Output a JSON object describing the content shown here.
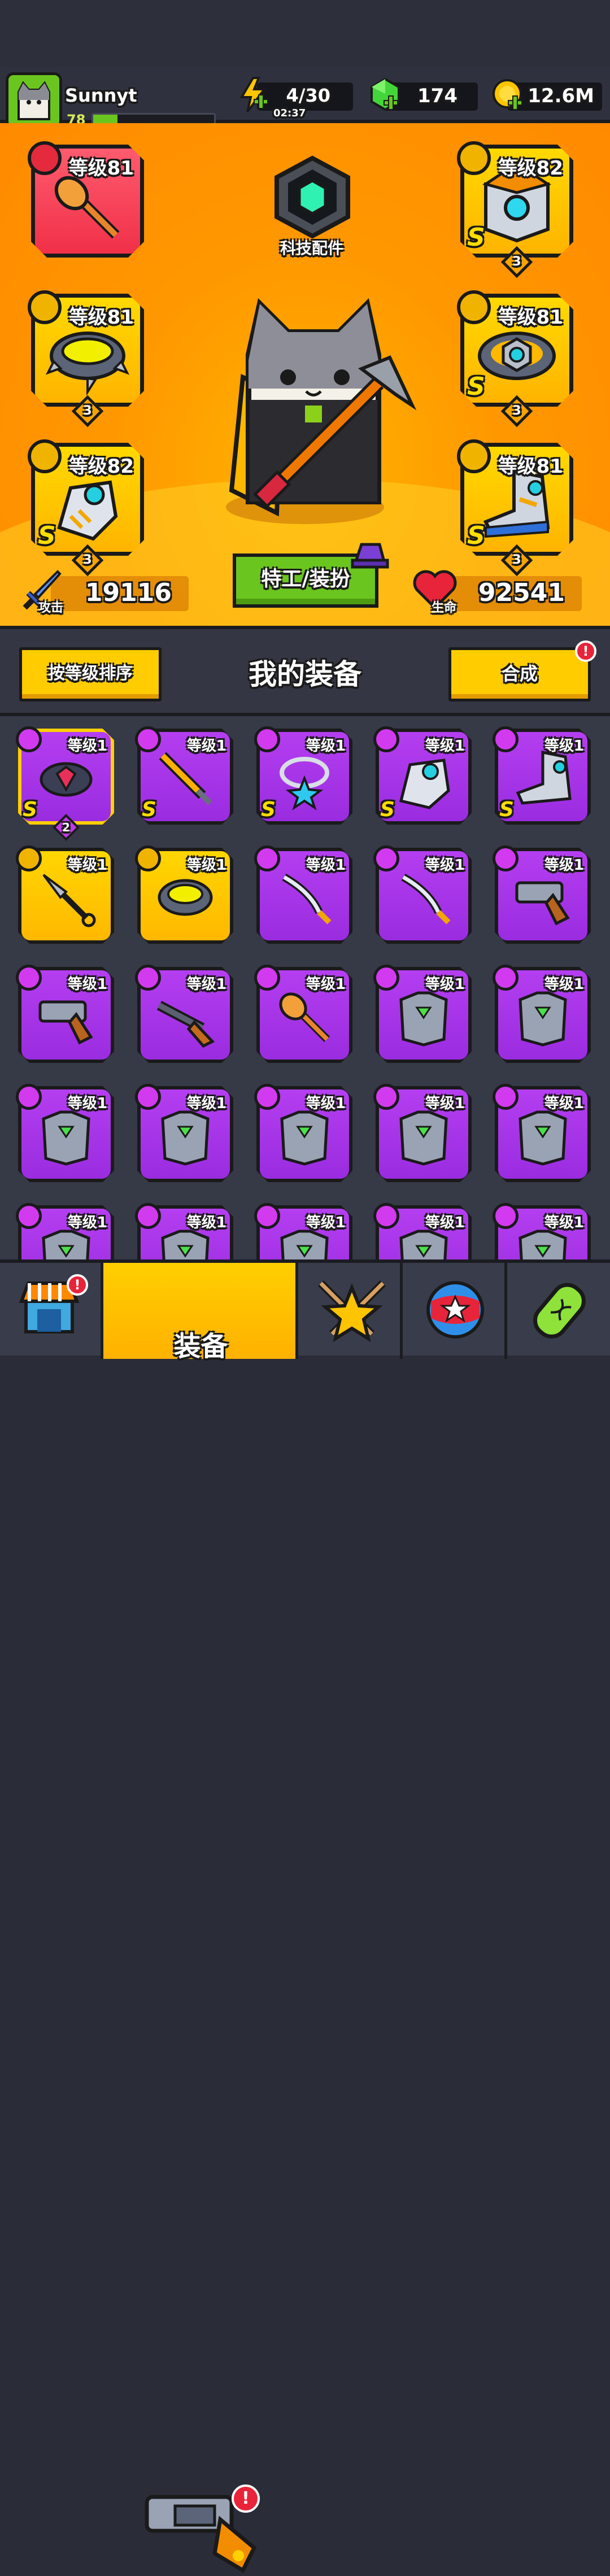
{
  "player": {
    "name": "Sunnyt",
    "level": "78",
    "xp_fraction": 0.2
  },
  "resources": {
    "energy": {
      "value": "4/30",
      "timer": "02:37",
      "icon": "lightning-plus-icon"
    },
    "gems": {
      "value": "174",
      "icon": "green-gem-plus-icon"
    },
    "gold": {
      "value": "12.6M",
      "icon": "gold-coin-plus-icon"
    }
  },
  "equipped": {
    "weapon": {
      "level": "等级81",
      "icon": "mace-weapon-icon"
    },
    "armor": {
      "level": "等级82",
      "icon": "robot-armor-icon",
      "stars": "3"
    },
    "necklace": {
      "level": "等级81",
      "icon": "spiked-necklace-icon",
      "stars": "3"
    },
    "belt": {
      "level": "等级81",
      "icon": "mech-belt-icon",
      "stars": "3"
    },
    "gloves": {
      "level": "等级82",
      "icon": "mech-glove-icon",
      "stars": "3"
    },
    "boots": {
      "level": "等级81",
      "icon": "mech-boots-icon",
      "stars": "3"
    },
    "rank_letter": "S"
  },
  "tech": {
    "label": "科技配件"
  },
  "costume_button": "特工/装扮",
  "stats": {
    "attack": {
      "label": "攻击",
      "value": "19116"
    },
    "hp": {
      "label": "生命",
      "value": "92541"
    }
  },
  "panel": {
    "sort_button": "按等级排序",
    "title": "我的装备",
    "merge_button": "合成",
    "merge_badge": "!"
  },
  "inventory_level": "等级1",
  "inventory": [
    {
      "rarity": "purple",
      "selected": true,
      "rank": "S",
      "stars": "2",
      "icon": "belt-icon"
    },
    {
      "rarity": "purple",
      "rank": "S",
      "icon": "flame-sword-icon"
    },
    {
      "rarity": "purple",
      "rank": "S",
      "icon": "star-necklace-icon"
    },
    {
      "rarity": "purple",
      "rank": "S",
      "icon": "mech-glove-icon"
    },
    {
      "rarity": "purple",
      "rank": "S",
      "icon": "mech-boots-icon"
    },
    {
      "rarity": "yellow",
      "icon": "kunai-icon"
    },
    {
      "rarity": "yellow",
      "icon": "spiked-necklace-icon"
    },
    {
      "rarity": "purple",
      "icon": "katana-icon"
    },
    {
      "rarity": "purple",
      "icon": "katana-icon"
    },
    {
      "rarity": "purple",
      "icon": "revolver-icon"
    },
    {
      "rarity": "purple",
      "icon": "revolver-icon"
    },
    {
      "rarity": "purple",
      "icon": "shotgun-icon"
    },
    {
      "rarity": "purple",
      "icon": "mace-icon"
    },
    {
      "rarity": "purple",
      "icon": "chest-armor-icon"
    },
    {
      "rarity": "purple",
      "icon": "chest-armor-icon"
    },
    {
      "rarity": "purple",
      "icon": "chest-armor-icon"
    },
    {
      "rarity": "purple",
      "icon": "chest-armor-icon"
    },
    {
      "rarity": "purple",
      "icon": "chest-armor-icon"
    },
    {
      "rarity": "purple",
      "icon": "chest-armor-icon"
    },
    {
      "rarity": "purple",
      "icon": "chest-armor-icon"
    },
    {
      "rarity": "purple",
      "icon": "chest-armor-icon"
    },
    {
      "rarity": "purple",
      "icon": "chest-armor-icon"
    },
    {
      "rarity": "purple",
      "icon": "chest-armor-icon"
    },
    {
      "rarity": "purple",
      "icon": "chest-armor-icon"
    },
    {
      "rarity": "purple",
      "icon": "chest-armor-icon"
    }
  ],
  "nav": {
    "tabs": [
      {
        "icon": "shop-icon",
        "badge": "!"
      },
      {
        "label": "装备",
        "icon": "revolver-icon",
        "active": true,
        "badge": "!"
      },
      {
        "icon": "star-swords-icon"
      },
      {
        "icon": "stars-ball-icon"
      },
      {
        "icon": "dna-capsule-icon"
      }
    ]
  },
  "colors": {
    "accent": "#ffcc00",
    "purple": "#a63ae8",
    "orange": "#ff9800",
    "green": "#6ac51e",
    "red": "#e52a3d"
  }
}
